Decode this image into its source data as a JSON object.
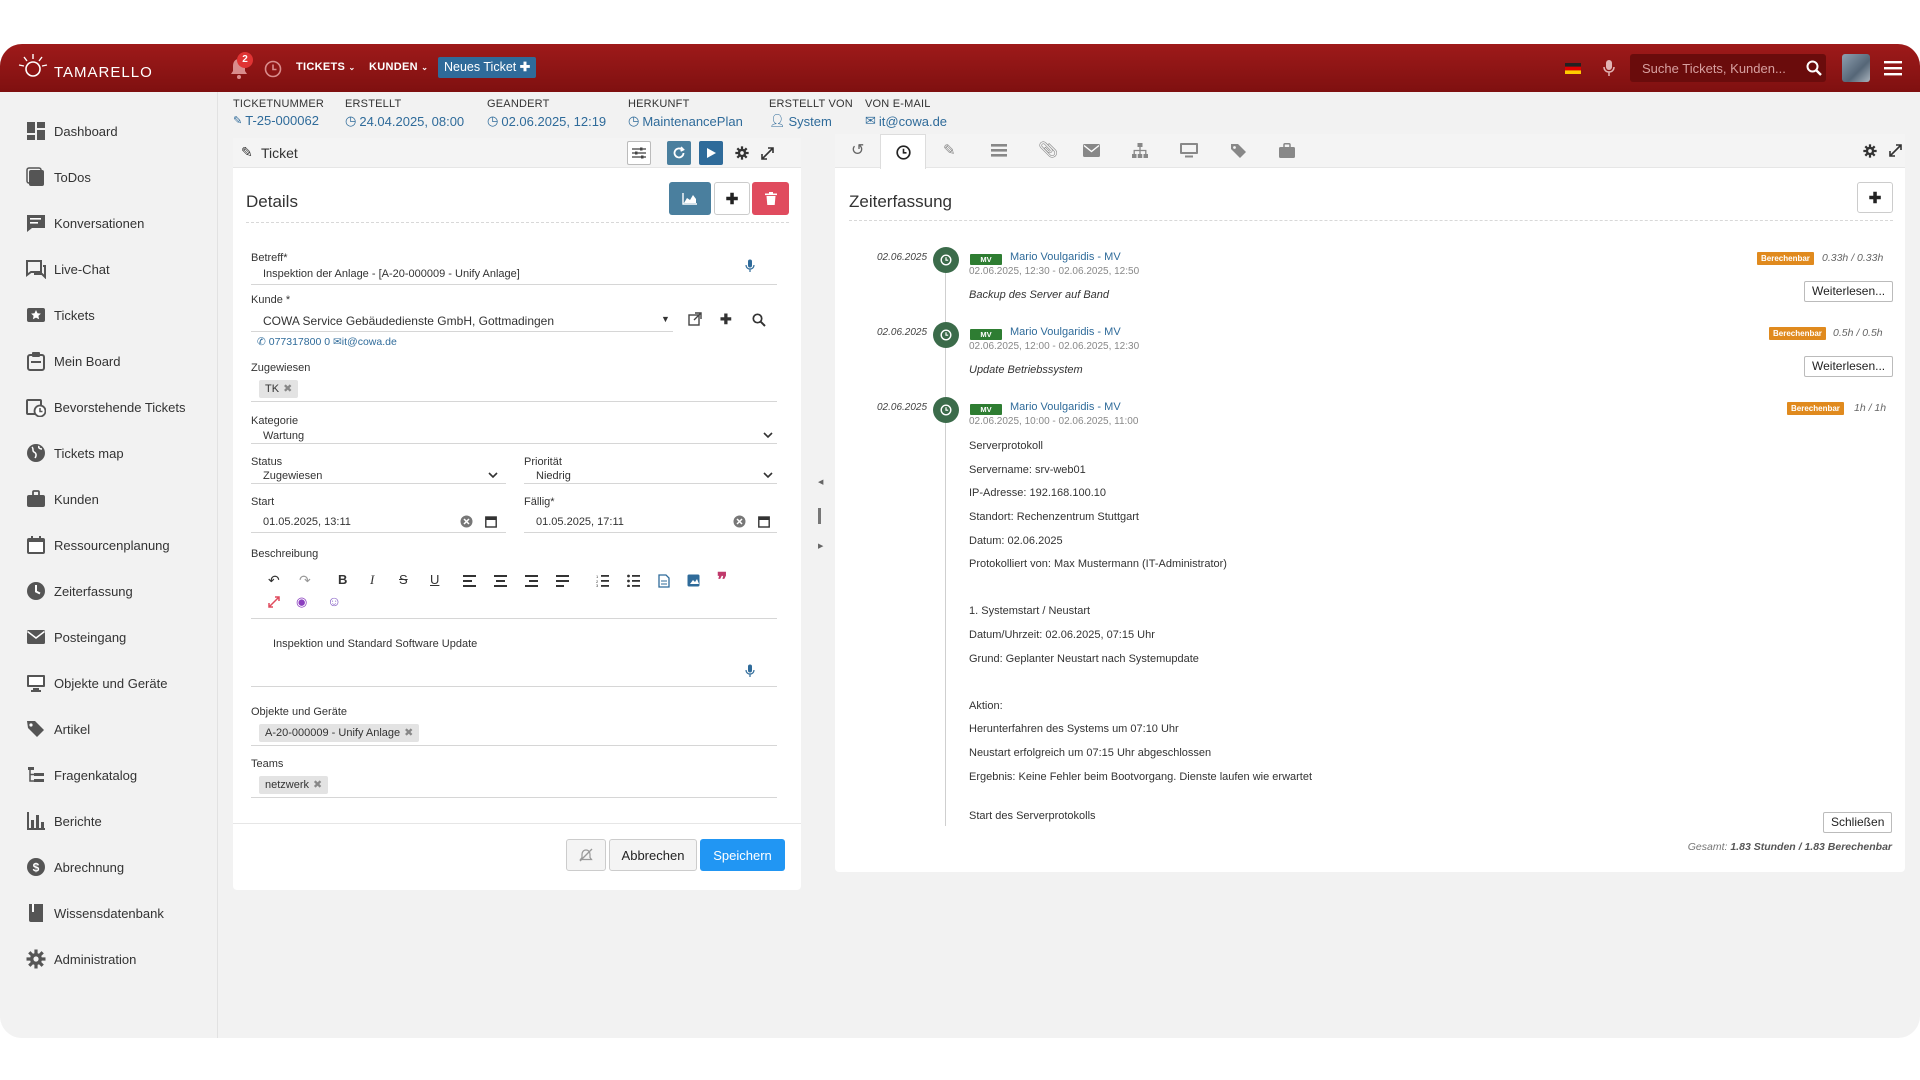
{
  "topbar": {
    "logo_text": "TAMARELLO",
    "notification_count": "2",
    "nav": {
      "tickets": "TICKETS",
      "kunden": "KUNDEN"
    },
    "new_ticket_label": "Neues Ticket",
    "search_placeholder": "Suche Tickets, Kunden..."
  },
  "sidebar": {
    "items": [
      {
        "label": "Dashboard",
        "icon": "dashboard-icon"
      },
      {
        "label": "ToDos",
        "icon": "todo-icon"
      },
      {
        "label": "Konversationen",
        "icon": "conversation-icon"
      },
      {
        "label": "Live-Chat",
        "icon": "chat-icon"
      },
      {
        "label": "Tickets",
        "icon": "ticket-icon"
      },
      {
        "label": "Mein Board",
        "icon": "board-icon"
      },
      {
        "label": "Bevorstehende Tickets",
        "icon": "calendar-clock-icon"
      },
      {
        "label": "Tickets map",
        "icon": "globe-icon"
      },
      {
        "label": "Kunden",
        "icon": "briefcase-icon"
      },
      {
        "label": "Ressourcenplanung",
        "icon": "calendar-icon"
      },
      {
        "label": "Zeiterfassung",
        "icon": "clock-icon"
      },
      {
        "label": "Posteingang",
        "icon": "envelope-icon"
      },
      {
        "label": "Objekte und Geräte",
        "icon": "monitor-icon"
      },
      {
        "label": "Artikel",
        "icon": "tags-icon"
      },
      {
        "label": "Fragenkatalog",
        "icon": "tree-icon"
      },
      {
        "label": "Berichte",
        "icon": "bar-chart-icon"
      },
      {
        "label": "Abrechnung",
        "icon": "dollar-icon"
      },
      {
        "label": "Wissensdatenbank",
        "icon": "book-icon"
      },
      {
        "label": "Administration",
        "icon": "gear-icon"
      }
    ]
  },
  "meta": [
    {
      "key": "TICKETNUMMER",
      "value": "T-25-000062"
    },
    {
      "key": "ERSTELLT",
      "value": "24.04.2025, 08:00"
    },
    {
      "key": "GEANDERT",
      "value": "02.06.2025, 12:19"
    },
    {
      "key": "HERKUNFT",
      "value": "MaintenancePlan"
    },
    {
      "key": "ERSTELLT VON",
      "value": "System"
    },
    {
      "key": "VON E-MAIL",
      "value": "it@cowa.de"
    }
  ],
  "ticket_panel": {
    "title": "Ticket",
    "details_title": "Details",
    "fields": {
      "betreff_label": "Betreff*",
      "betreff_value": "Inspektion der Anlage - [A-20-000009 - Unify Anlage]",
      "kunde_label": "Kunde *",
      "kunde_value": "COWA Service Gebäudedienste GmbH, Gottmadingen",
      "kunde_phone": "077317800 0",
      "kunde_email": "it@cowa.de",
      "zugewiesen_label": "Zugewiesen",
      "zugewiesen_chip": "TK",
      "kategorie_label": "Kategorie",
      "kategorie_value": "Wartung",
      "status_label": "Status",
      "status_value": "Zugewiesen",
      "prioritaet_label": "Priorität",
      "prioritaet_value": "Niedrig",
      "start_label": "Start",
      "start_value": "01.05.2025, 13:11",
      "faellig_label": "Fällig*",
      "faellig_value": "01.05.2025, 17:11",
      "beschreibung_label": "Beschreibung",
      "beschreibung_value": "Inspektion und Standard Software Update",
      "objekte_label": "Objekte und Geräte",
      "objekte_chip": "A-20-000009 - Unify Anlage",
      "teams_label": "Teams",
      "teams_chip": "netzwerk"
    },
    "cancel_label": "Abbrechen",
    "save_label": "Speichern"
  },
  "time_panel": {
    "title": "Zeiterfassung",
    "entries": [
      {
        "date": "02.06.2025",
        "badge": "MV",
        "name": "Mario Voulgaridis - MV",
        "range": "02.06.2025, 12:30 - 02.06.2025, 12:50",
        "desc": "Backup des Server auf Band",
        "tag": "Berechenbar",
        "hours": "0.33h / 0.33h",
        "button": "Weiterlesen..."
      },
      {
        "date": "02.06.2025",
        "badge": "MV",
        "name": "Mario Voulgaridis - MV",
        "range": "02.06.2025, 12:00 - 02.06.2025, 12:30",
        "desc": "Update Betriebssystem",
        "tag": "Berechenbar",
        "hours": "0.5h / 0.5h",
        "button": "Weiterlesen..."
      },
      {
        "date": "02.06.2025",
        "badge": "MV",
        "name": "Mario Voulgaridis - MV",
        "range": "02.06.2025, 10:00 - 02.06.2025, 11:00",
        "tag": "Berechenbar",
        "hours": "1h / 1h",
        "button": "Schließen"
      }
    ],
    "protocol_lines": [
      "Serverprotokoll",
      "Servername: srv-web01",
      "IP-Adresse: 192.168.100.10",
      "Standort: Rechenzentrum Stuttgart",
      "Datum: 02.06.2025",
      "Protokolliert von: Max Mustermann (IT-Administrator)",
      "1. Systemstart / Neustart",
      "Datum/Uhrzeit: 02.06.2025, 07:15 Uhr",
      "Grund: Geplanter Neustart nach Systemupdate",
      "Aktion:",
      "Herunterfahren des Systems um 07:10 Uhr",
      "Neustart erfolgreich um 07:15 Uhr abgeschlossen",
      "Ergebnis: Keine Fehler beim Bootvorgang. Dienste laufen wie erwartet",
      "Start des Serverprotokolls"
    ],
    "total_prefix": "Gesamt:",
    "total_value": "1.83 Stunden / 1.83 Berechenbar"
  },
  "colors": {
    "brand_red": "#8b1313",
    "link_blue": "#2f6b9a",
    "primary_blue": "#2196f3",
    "danger": "#e04b5e",
    "timeline_green": "#3b6b4a",
    "berechenbar": "#e08a1e"
  }
}
